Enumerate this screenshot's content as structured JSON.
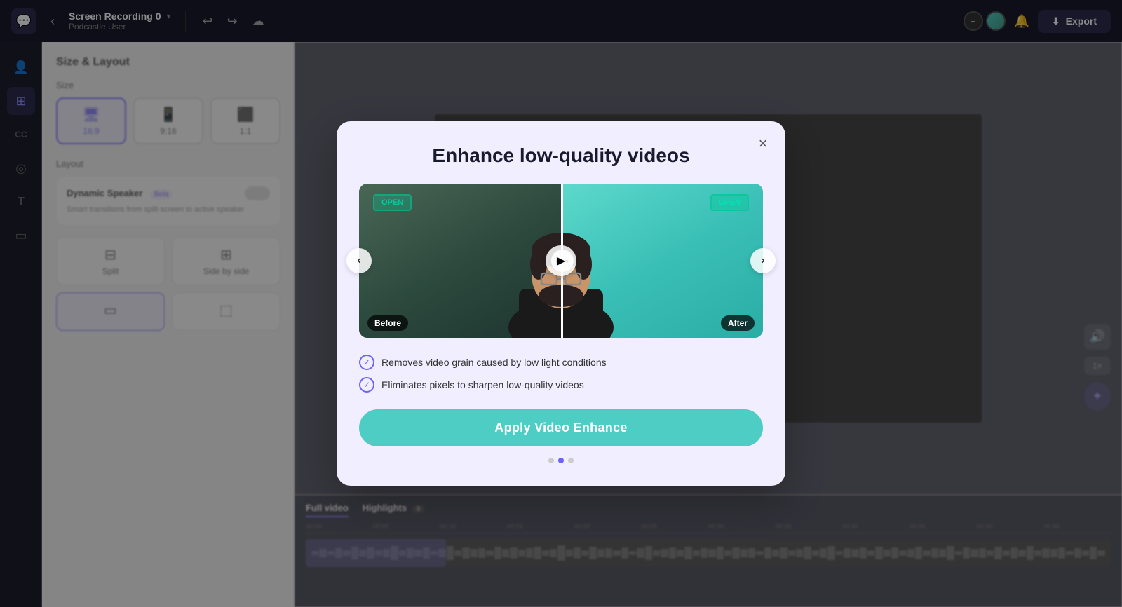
{
  "app": {
    "logo_icon": "💬",
    "project_name": "Screen Recording 0",
    "project_user": "Podcastle User",
    "export_label": "Export"
  },
  "toolbar": {
    "undo_icon": "↩",
    "redo_icon": "↪",
    "save_icon": "☁"
  },
  "topbar_right": {
    "add_icon": "+",
    "notification_icon": "🔔",
    "export_icon": "⬇"
  },
  "sidebar_icons": [
    {
      "name": "person",
      "icon": "👤",
      "active": false
    },
    {
      "name": "grid",
      "icon": "⊞",
      "active": true
    },
    {
      "name": "captions",
      "icon": "CC",
      "active": false
    },
    {
      "name": "layers",
      "icon": "◎",
      "active": false
    },
    {
      "name": "text",
      "icon": "T",
      "active": false
    },
    {
      "name": "media",
      "icon": "▭",
      "active": false
    }
  ],
  "left_panel": {
    "title": "Size & Layout",
    "size_label": "Size",
    "sizes": [
      {
        "label": "16:9",
        "icon": "🖥",
        "active": true
      },
      {
        "label": "9:16",
        "icon": "📱",
        "active": false
      },
      {
        "label": "1:1",
        "icon": "⬛",
        "active": false
      }
    ],
    "layout_label": "Layout",
    "dynamic_speaker": {
      "title": "Dynamic Speaker",
      "beta": "Beta",
      "desc": "Smart transitions from split-screen to active speaker"
    },
    "layouts": [
      {
        "label": "Split",
        "icon": "⊟",
        "active": false
      },
      {
        "label": "Side by side",
        "icon": "⊞",
        "active": false
      }
    ]
  },
  "timeline": {
    "tabs": [
      {
        "label": "Full video",
        "active": true
      },
      {
        "label": "Highlights",
        "count": "0",
        "active": false
      }
    ],
    "ruler_marks": [
      "00:00",
      "00:05",
      "00:10",
      "00:15",
      "00:20",
      "00:25",
      "00:30",
      "00:35",
      "00:40",
      "00:45",
      "00:50",
      "00:55"
    ]
  },
  "modal": {
    "title": "Enhance low-quality videos",
    "before_label": "Before",
    "after_label": "After",
    "features": [
      "Removes video grain caused by low light conditions",
      "Eliminates pixels to sharpen low-quality videos"
    ],
    "apply_button": "Apply Video Enhance",
    "dots": [
      {
        "active": false
      },
      {
        "active": true
      },
      {
        "active": false
      }
    ],
    "prev_icon": "‹",
    "next_icon": "›",
    "close_icon": "×",
    "play_icon": "▶"
  }
}
